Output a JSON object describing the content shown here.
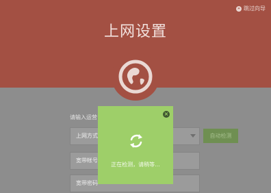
{
  "header": {
    "title": "上网设置",
    "skip_label": "跳过向导",
    "skip_icon": "skip-icon",
    "globe_icon": "globe-icon",
    "color": "#a35043"
  },
  "form": {
    "prompt": "请输入运营",
    "connection_type_label": "上网方式",
    "detect_button_label": "自动检测",
    "account_label": "宽带帐号",
    "password_label": "宽带密码"
  },
  "modal": {
    "message": "正在检测，请稍等...",
    "close_icon": "close-icon",
    "spinner_icon": "refresh-icon",
    "color": "#9ecf69"
  }
}
